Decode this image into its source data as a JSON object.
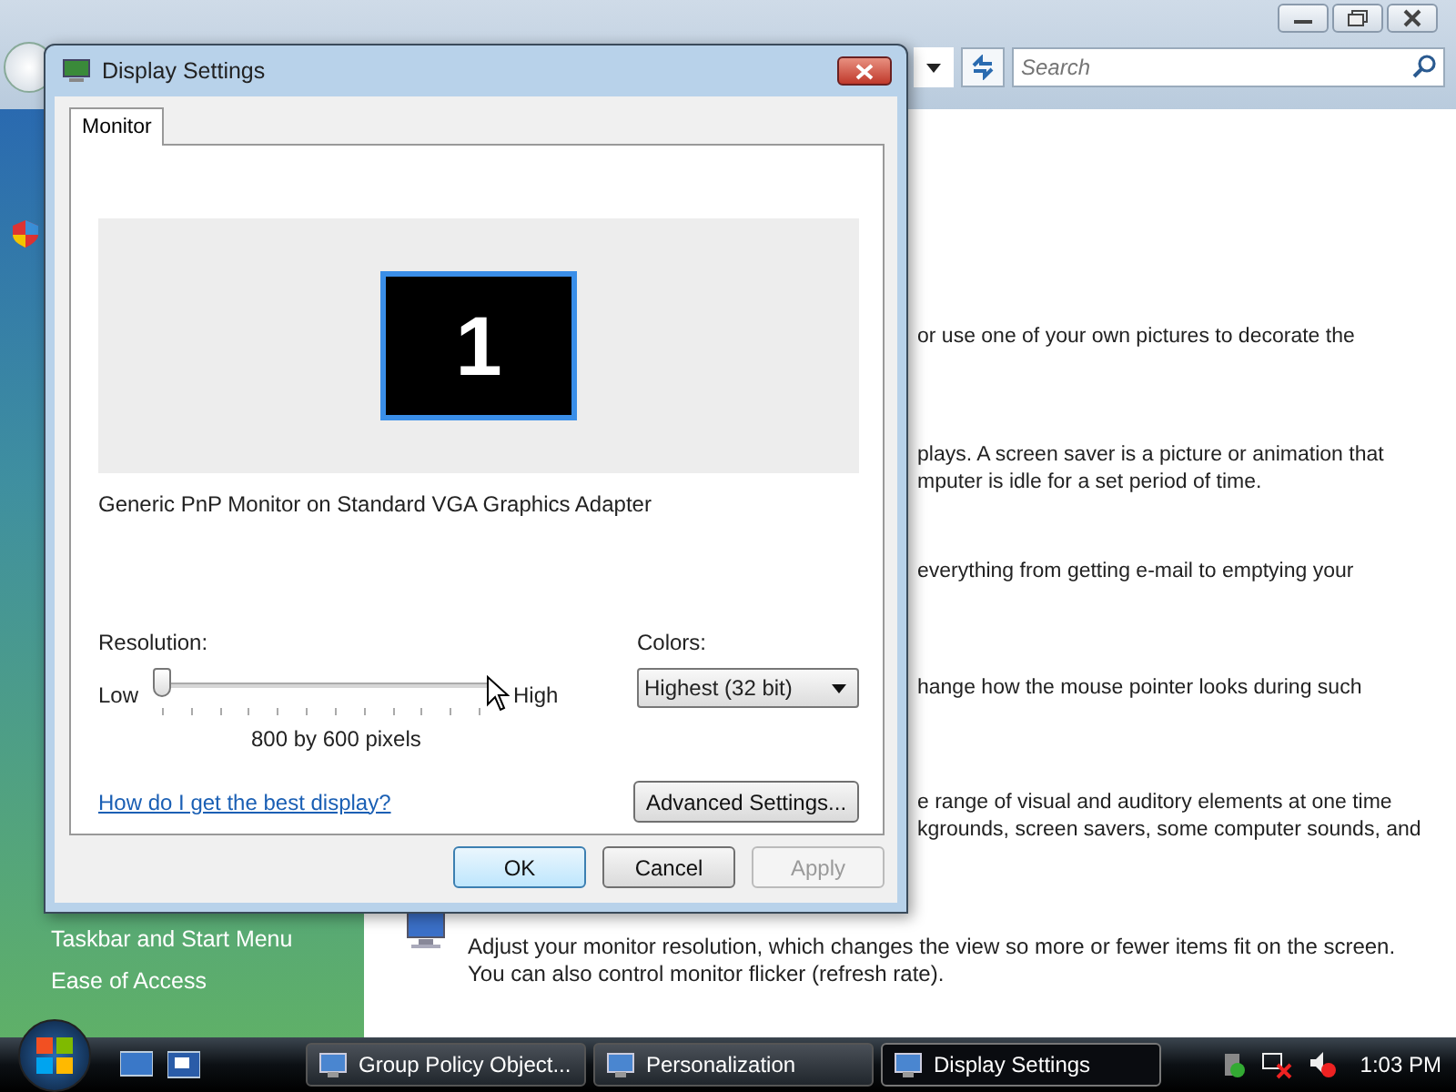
{
  "explorer": {
    "search": {
      "placeholder": "Search"
    },
    "sidebar": {
      "items": [
        {
          "label": "Taskbar and Start Menu"
        },
        {
          "label": "Ease of Access"
        }
      ]
    },
    "content": {
      "paragraphs": [
        {
          "lines": [
            "or use one of your own pictures to decorate the"
          ]
        },
        {
          "lines": [
            "plays. A screen saver is a picture or animation that",
            "mputer is idle for a set period of time."
          ]
        },
        {
          "lines": [
            "everything from getting e-mail to emptying your"
          ]
        },
        {
          "lines": [
            "hange how the mouse pointer looks during such"
          ]
        },
        {
          "lines": [
            "e range of visual and auditory elements at one time",
            "kgrounds, screen savers, some computer sounds, and"
          ]
        }
      ],
      "display_description": [
        "Adjust your monitor resolution, which changes the view so more or fewer items fit on the screen.",
        "You can also control monitor flicker (refresh rate)."
      ]
    }
  },
  "dialog": {
    "title": "Display Settings",
    "tabs": [
      {
        "label": "Monitor",
        "selected": true
      }
    ],
    "monitor_number": "1",
    "monitor_name": "Generic PnP Monitor on Standard VGA Graphics Adapter",
    "resolution": {
      "label": "Resolution:",
      "low": "Low",
      "high": "High",
      "level": 0,
      "reading": "800 by 600 pixels"
    },
    "colors": {
      "label": "Colors:",
      "value": "Highest (32 bit)"
    },
    "help_link": "How do I get the best display?",
    "advanced_button": "Advanced Settings...",
    "buttons": [
      {
        "label": "OK",
        "default": true,
        "disabled": false
      },
      {
        "label": "Cancel",
        "default": false,
        "disabled": false
      },
      {
        "label": "Apply",
        "default": false,
        "disabled": true
      }
    ]
  },
  "taskbar": {
    "tasks": [
      {
        "label": "Group Policy Object...",
        "selected": false
      },
      {
        "label": "Personalization",
        "selected": false
      },
      {
        "label": "Display Settings",
        "selected": true
      }
    ],
    "clock": "1:03 PM"
  }
}
